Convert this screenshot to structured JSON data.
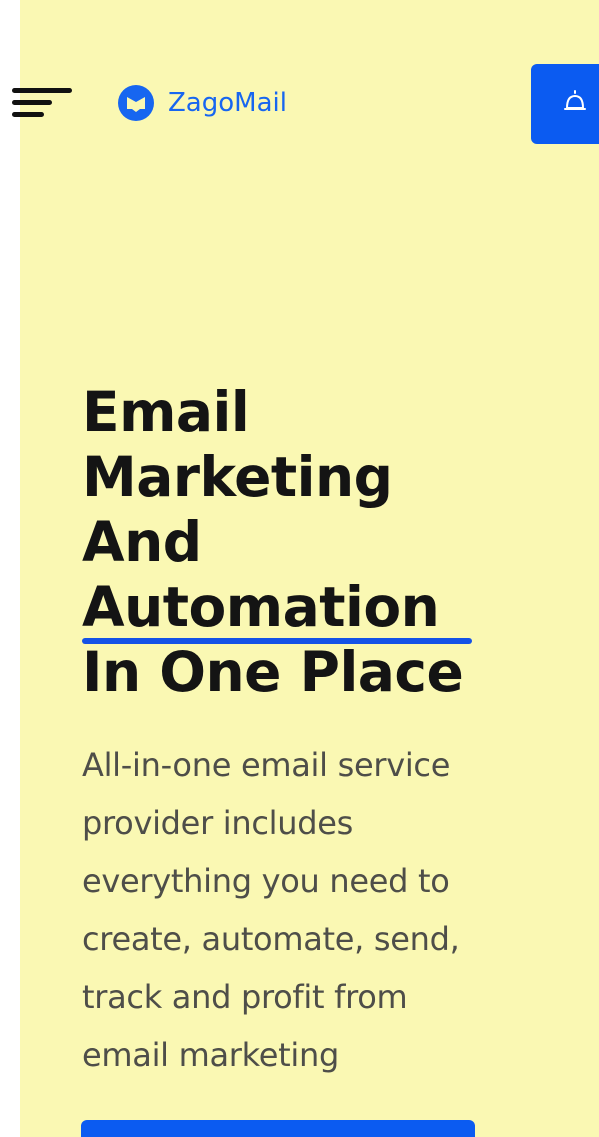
{
  "header": {
    "brand_name": "ZagoMail",
    "menu_icon": "hamburger-menu-icon",
    "brand_icon": "zagomail-logo-icon",
    "corner_icon": "bell-icon"
  },
  "hero": {
    "headline_lines": [
      "Email",
      "Marketing",
      "And"
    ],
    "headline_accent": "Automation",
    "headline_last": "In One Place",
    "subtext_lines": [
      "All-in-one email service",
      "provider includes",
      "everything you need to",
      "create, automate, send,",
      "track and profit from",
      "email marketing"
    ]
  },
  "colors": {
    "background": "#FAF8B3",
    "brand": "#1766F0",
    "accent_button": "#0B5BF1",
    "headline": "#141414",
    "subtext": "#4E4E49",
    "underline": "#1452E6"
  }
}
